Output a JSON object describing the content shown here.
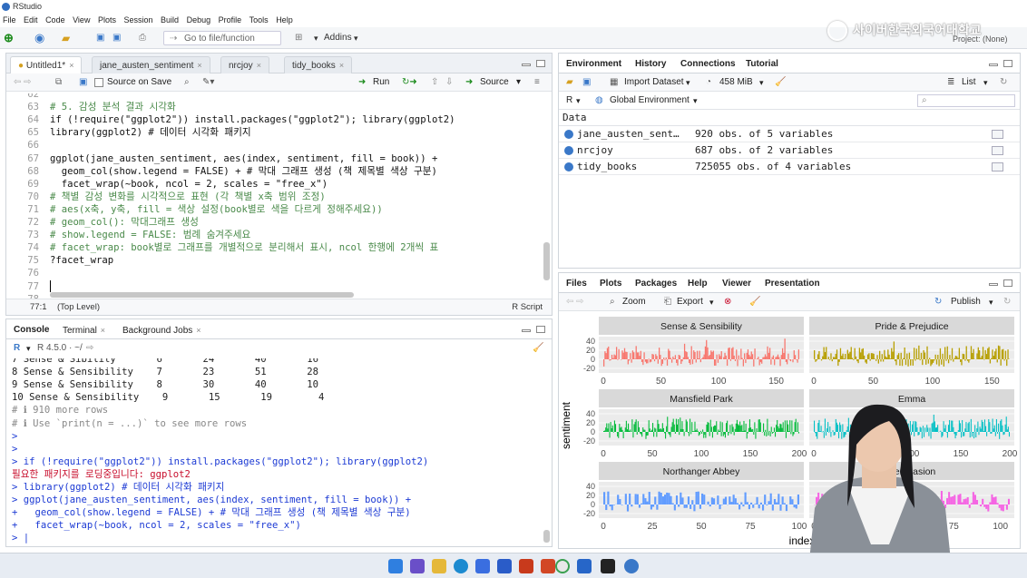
{
  "window": {
    "title": "RStudio"
  },
  "menu": [
    "File",
    "Edit",
    "Code",
    "View",
    "Plots",
    "Session",
    "Build",
    "Debug",
    "Profile",
    "Tools",
    "Help"
  ],
  "toolbar": {
    "goto_placeholder": "Go to file/function",
    "addins": "Addins"
  },
  "watermark": "사이버한국외국어대학교",
  "project": "Project: (None)",
  "editor": {
    "tabs": [
      "Untitled1*",
      "jane_austen_sentiment",
      "nrcjoy",
      "tidy_books"
    ],
    "source_on_save": "Source on Save",
    "run": "Run",
    "source": "Source",
    "lines": [
      {
        "n": "62",
        "t": ""
      },
      {
        "n": "63",
        "t": "# 5. 감성 분석 결과 시각화"
      },
      {
        "n": "64",
        "t": "if (!require(\"ggplot2\")) install.packages(\"ggplot2\"); library(ggplot2)"
      },
      {
        "n": "65",
        "t": "library(ggplot2) # 데이터 시각화 패키지"
      },
      {
        "n": "66",
        "t": ""
      },
      {
        "n": "67",
        "t": "ggplot(jane_austen_sentiment, aes(index, sentiment, fill = book)) +"
      },
      {
        "n": "68",
        "t": "  geom_col(show.legend = FALSE) + # 막대 그래프 생성 (책 제목별 색상 구분)"
      },
      {
        "n": "69",
        "t": "  facet_wrap(~book, ncol = 2, scales = \"free_x\")"
      },
      {
        "n": "70",
        "t": "# 책별 감성 변화를 시각적으로 표현 (각 책별 x축 범위 조정)"
      },
      {
        "n": "71",
        "t": "# aes(x축, y축, fill = 색상 설정(book별로 색을 다르게 정해주세요))"
      },
      {
        "n": "72",
        "t": "# geom_col(): 막대그래프 생성"
      },
      {
        "n": "73",
        "t": "# show.legend = FALSE: 범례 숨겨주세요"
      },
      {
        "n": "74",
        "t": "# facet_wrap: book별로 그래프를 개별적으로 분리해서 표시, ncol 한행에 2개씩 표"
      },
      {
        "n": "75",
        "t": "?facet_wrap"
      },
      {
        "n": "76",
        "t": ""
      },
      {
        "n": "77",
        "t": ""
      },
      {
        "n": "78",
        "t": ""
      }
    ],
    "status_pos": "77:1",
    "status_level": "(Top Level)",
    "status_type": "R Script"
  },
  "console": {
    "tabs": [
      "Console",
      "Terminal",
      "Background Jobs"
    ],
    "r_version": "R 4.5.0 · ~/",
    "lines": [
      {
        "t": "7 Sense & Sibility       6       24       40       16",
        "c": ""
      },
      {
        "t": "8 Sense & Sensibility    7       23       51       28",
        "c": ""
      },
      {
        "t": "9 Sense & Sensibility    8       30       40       10",
        "c": ""
      },
      {
        "t": "10 Sense & Sensibility    9       15       19        4",
        "c": ""
      },
      {
        "t": "# ℹ 910 more rows",
        "c": "grey"
      },
      {
        "t": "# ℹ Use `print(n = ...)` to see more rows",
        "c": "grey"
      },
      {
        "t": ">",
        "c": "blue"
      },
      {
        "t": ">",
        "c": "blue"
      },
      {
        "t": "> if (!require(\"ggplot2\")) install.packages(\"ggplot2\"); library(ggplot2)",
        "c": "blue"
      },
      {
        "t": "필요한 패키지를 로딩중입니다: ggplot2",
        "c": "red"
      },
      {
        "t": "> library(ggplot2) # 데이터 시각화 패키지",
        "c": "blue"
      },
      {
        "t": "> ggplot(jane_austen_sentiment, aes(index, sentiment, fill = book)) +",
        "c": "blue"
      },
      {
        "t": "+   geom_col(show.legend = FALSE) + # 막대 그래프 생성 (책 제목별 색상 구분)",
        "c": "blue"
      },
      {
        "t": "+   facet_wrap(~book, ncol = 2, scales = \"free_x\")",
        "c": "blue"
      },
      {
        "t": "> |",
        "c": "blue"
      }
    ]
  },
  "environment": {
    "tabs": [
      "Environment",
      "History",
      "Connections",
      "Tutorial"
    ],
    "import": "Import Dataset",
    "memory": "458 MiB",
    "list": "List",
    "r": "R",
    "global": "Global Environment",
    "section": "Data",
    "rows": [
      {
        "name": "jane_austen_sent…",
        "value": "920 obs. of 5 variables"
      },
      {
        "name": "nrcjoy",
        "value": "687 obs. of 2 variables"
      },
      {
        "name": "tidy_books",
        "value": "725055 obs. of 4 variables"
      }
    ]
  },
  "files": {
    "tabs": [
      "Files",
      "Plots",
      "Packages",
      "Help",
      "Viewer",
      "Presentation"
    ],
    "zoom": "Zoom",
    "export": "Export",
    "publish": "Publish"
  },
  "chart_data": {
    "type": "bar",
    "ylabel": "sentiment",
    "xlabel": "index",
    "facets": [
      {
        "name": "Sense & Sensibility",
        "color": "#F8766D",
        "xticks": [
          "0",
          "50",
          "100",
          "150"
        ],
        "xmax": 170
      },
      {
        "name": "Pride & Prejudice",
        "color": "#B79F00",
        "xticks": [
          "0",
          "50",
          "100",
          "150"
        ],
        "xmax": 165
      },
      {
        "name": "Mansfield Park",
        "color": "#00BA38",
        "xticks": [
          "0",
          "50",
          "100",
          "150",
          "200"
        ],
        "xmax": 200
      },
      {
        "name": "Emma",
        "color": "#00BFC4",
        "xticks": [
          "0",
          "50",
          "100",
          "150",
          "200"
        ],
        "xmax": 200
      },
      {
        "name": "Northanger Abbey",
        "color": "#619CFF",
        "xticks": [
          "0",
          "25",
          "50",
          "75",
          "100"
        ],
        "xmax": 100
      },
      {
        "name": "Persuasion",
        "color": "#F564E3",
        "xticks": [
          "0",
          "25",
          "50",
          "75",
          "100"
        ],
        "xmax": 105
      }
    ],
    "yticks": [
      "40",
      "20",
      "0",
      "-20"
    ],
    "ylim": [
      -30,
      50
    ]
  }
}
